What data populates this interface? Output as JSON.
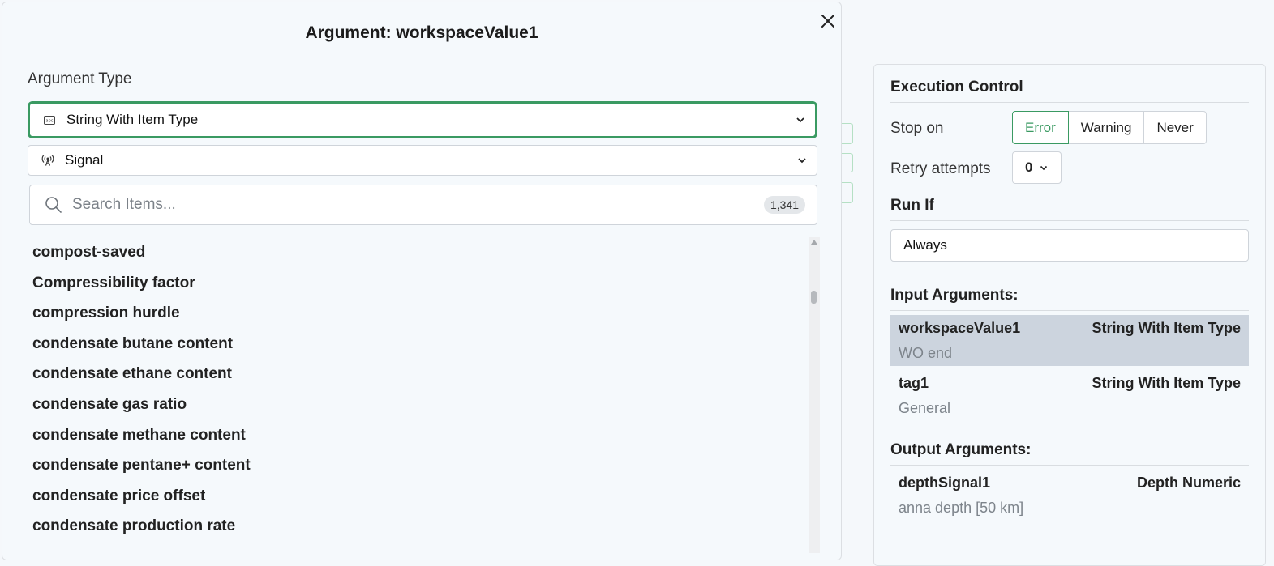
{
  "modal": {
    "title": "Argument: workspaceValue1",
    "argument_type_label": "Argument Type",
    "type_select": {
      "value": "String With Item Type",
      "icon": "abc-string-icon"
    },
    "item_type_select": {
      "value": "Signal",
      "icon": "signal-broadcast-icon"
    },
    "search": {
      "placeholder": "Search Items...",
      "count": "1,341"
    },
    "items": [
      "compost-saved",
      "Compressibility factor",
      "compression hurdle",
      "condensate butane content",
      "condensate ethane content",
      "condensate gas ratio",
      "condensate methane content",
      "condensate pentane+ content",
      "condensate price offset",
      "condensate production rate"
    ]
  },
  "panel": {
    "execution_control": "Execution Control",
    "stop_on_label": "Stop on",
    "stop_on_options": [
      "Error",
      "Warning",
      "Never"
    ],
    "stop_on_selected": "Error",
    "retry_label": "Retry attempts",
    "retry_value": "0",
    "run_if_heading": "Run If",
    "run_if_value": "Always",
    "input_heading": "Input Arguments:",
    "input_args": [
      {
        "name": "workspaceValue1",
        "type": "String With Item Type",
        "sub": "WO end",
        "selected": true
      },
      {
        "name": "tag1",
        "type": "String With Item Type",
        "sub": "General",
        "selected": false
      }
    ],
    "output_heading": "Output Arguments:",
    "output_args": [
      {
        "name": "depthSignal1",
        "type": "Depth Numeric",
        "sub": "anna depth [50 km]"
      }
    ]
  },
  "colors": {
    "accent": "#3a9a62",
    "selected_row": "#ccd4de",
    "muted": "#7d848b"
  }
}
